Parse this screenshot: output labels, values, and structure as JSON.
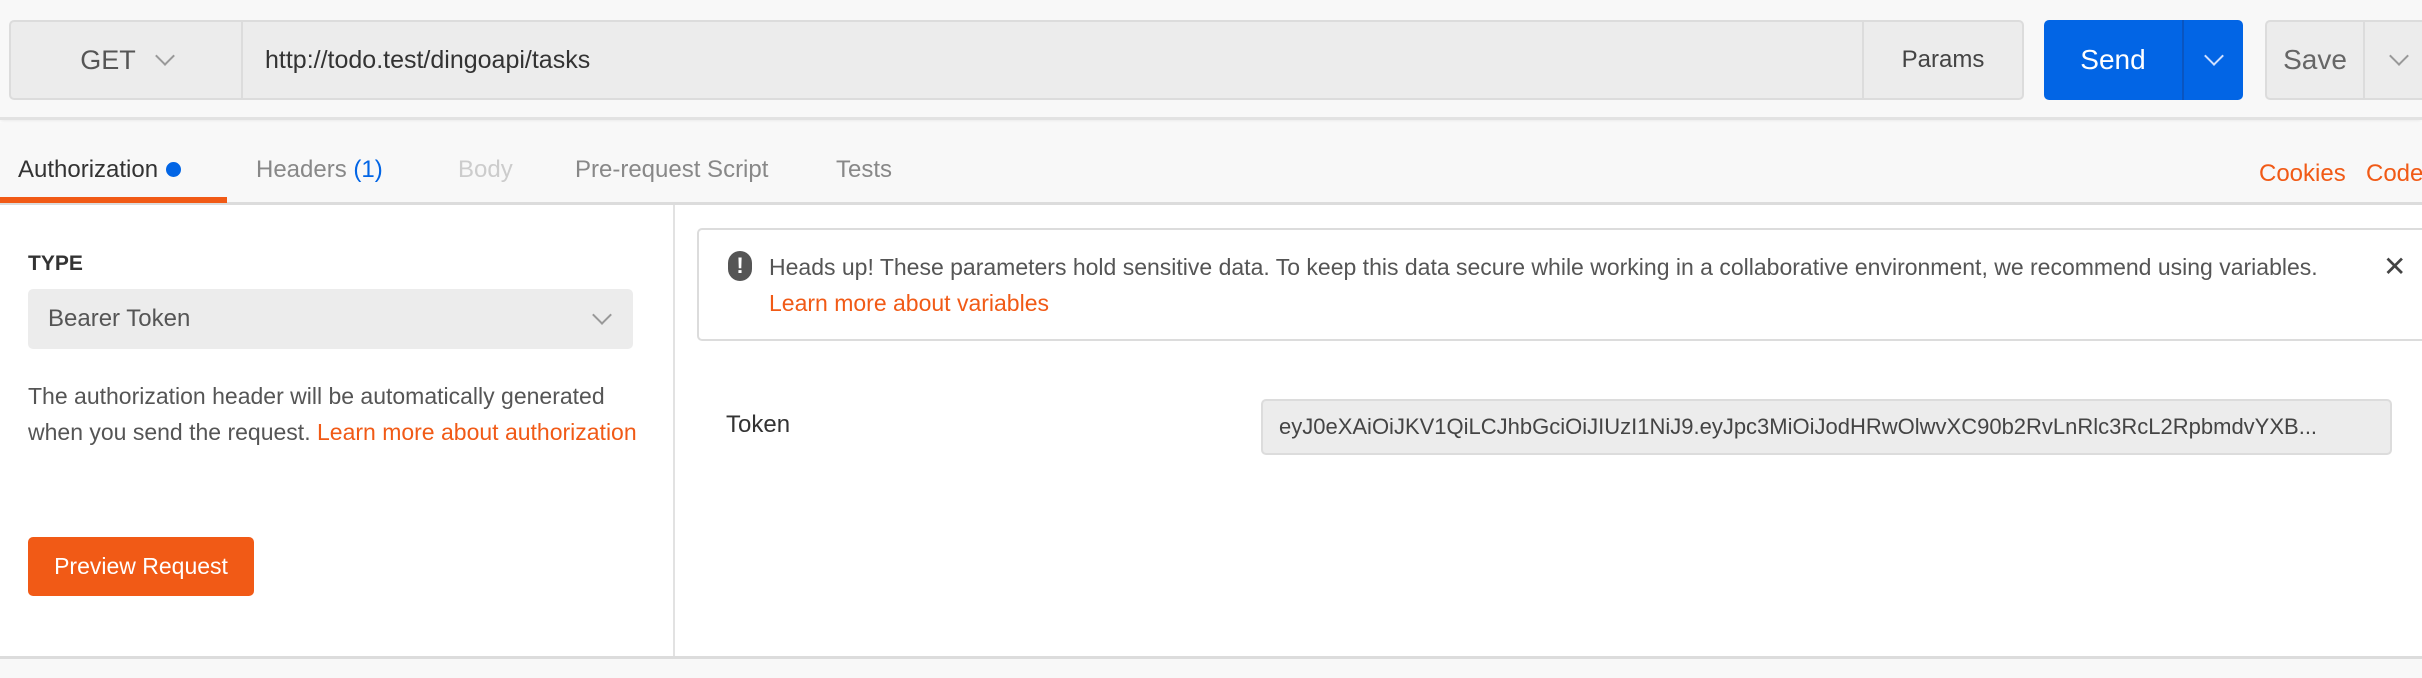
{
  "request": {
    "method": "GET",
    "url": "http://todo.test/dingoapi/tasks",
    "params_label": "Params",
    "send_label": "Send",
    "save_label": "Save"
  },
  "tabs": [
    {
      "label": "Authorization",
      "active": true
    },
    {
      "label": "Headers",
      "count": "(1)"
    },
    {
      "label": "Body",
      "disabled": true
    },
    {
      "label": "Pre-request Script"
    },
    {
      "label": "Tests"
    }
  ],
  "links": {
    "cookies": "Cookies",
    "code": "Code"
  },
  "auth": {
    "type_label": "TYPE",
    "type_value": "Bearer Token",
    "description": "The authorization header will be automatically generated when you send the request. ",
    "learn_more": "Learn more about authorization",
    "preview_label": "Preview Request"
  },
  "alert": {
    "text": "Heads up! These parameters hold sensitive data. To keep this data secure while working in a collaborative environment, we recommend using variables. ",
    "link": "Learn more about variables",
    "icon": "exclamation-circle-icon",
    "close_icon": "close-icon"
  },
  "token": {
    "label": "Token",
    "value": "eyJ0eXAiOiJKV1QiLCJhbGciOiJIUzI1NiJ9.eyJpc3MiOiJodHRwOlwvXC90b2RvLnRlc3RcL2RpbmdvYXB..."
  },
  "colors": {
    "accent": "#f15a16",
    "send": "#0265e5"
  }
}
